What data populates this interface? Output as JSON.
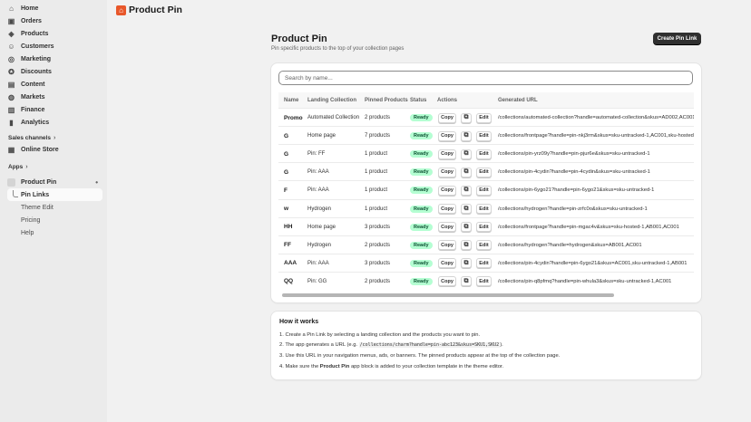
{
  "sidebar": {
    "nav": [
      {
        "label": "Home",
        "icon": "home-icon",
        "glyph": "⌂"
      },
      {
        "label": "Orders",
        "icon": "orders-icon",
        "glyph": "▣"
      },
      {
        "label": "Products",
        "icon": "products-icon",
        "glyph": "◈"
      },
      {
        "label": "Customers",
        "icon": "customers-icon",
        "glyph": "☺"
      },
      {
        "label": "Marketing",
        "icon": "marketing-icon",
        "glyph": "◎"
      },
      {
        "label": "Discounts",
        "icon": "discounts-icon",
        "glyph": "✪"
      },
      {
        "label": "Content",
        "icon": "content-icon",
        "glyph": "▤"
      },
      {
        "label": "Markets",
        "icon": "markets-icon",
        "glyph": "◍"
      },
      {
        "label": "Finance",
        "icon": "finance-icon",
        "glyph": "▥"
      },
      {
        "label": "Analytics",
        "icon": "analytics-icon",
        "glyph": "▮"
      }
    ],
    "sales_channels_label": "Sales channels",
    "online_store_label": "Online Store",
    "apps_label": "Apps",
    "app_name": "Product Pin",
    "app_sub": [
      "Pin Links",
      "Theme Edit",
      "Pricing",
      "Help"
    ]
  },
  "header": {
    "title": "Product Pin"
  },
  "page": {
    "title": "Product Pin",
    "subtitle": "Pin specific products to the top of your collection pages",
    "create_button": "Create Pin Link",
    "search_placeholder": "Search by name..."
  },
  "table": {
    "columns": [
      "Name",
      "Landing Collection",
      "Pinned Products",
      "Status",
      "Actions",
      "Generated URL"
    ],
    "copy_label": "Copy",
    "edit_label": "Edit",
    "rows": [
      {
        "name": "Promo",
        "collection": "Automated Collection",
        "pinned": "2 products",
        "status": "Ready",
        "url": "/collections/automated-collection?handle=automated-collection&skus=AD002,AC001"
      },
      {
        "name": "G",
        "collection": "Home page",
        "pinned": "7 products",
        "status": "Ready",
        "url": "/collections/frontpage?handle=pin-nkj3rm&skus=sku-untracked-1,AC001,sku-hosted-1"
      },
      {
        "name": "G",
        "collection": "Pin: FF",
        "pinned": "1 product",
        "status": "Ready",
        "url": "/collections/pin-yrz09y?handle=pin-pjur6e&skus=sku-untracked-1"
      },
      {
        "name": "G",
        "collection": "Pin: AAA",
        "pinned": "1 product",
        "status": "Ready",
        "url": "/collections/pin-4cydin?handle=pin-4cydin&skus=sku-untracked-1"
      },
      {
        "name": "F",
        "collection": "Pin: AAA",
        "pinned": "1 product",
        "status": "Ready",
        "url": "/collections/pin-6ygo21?handle=pin-6ygo21&skus=sku-untracked-1"
      },
      {
        "name": "w",
        "collection": "Hydrogen",
        "pinned": "1 product",
        "status": "Ready",
        "url": "/collections/hydrogen?handle=pin-zrfc0o&skus=sku-untracked-1"
      },
      {
        "name": "HH",
        "collection": "Home page",
        "pinned": "3 products",
        "status": "Ready",
        "url": "/collections/frontpage?handle=pin-mgac4v&skus=sku-hosted-1,AB001,AC001"
      },
      {
        "name": "FF",
        "collection": "Hydrogen",
        "pinned": "2 products",
        "status": "Ready",
        "url": "/collections/hydrogen?handle=hydrogen&skus=AB001,AC001"
      },
      {
        "name": "AAA",
        "collection": "Pin: AAA",
        "pinned": "3 products",
        "status": "Ready",
        "url": "/collections/pin-4cydin?handle=pin-6ygo21&skus=AC001,sku-untracked-1,AB001"
      },
      {
        "name": "QQ",
        "collection": "Pin: GG",
        "pinned": "2 products",
        "status": "Ready",
        "url": "/collections/pin-q8pfmq?handle=pin-whula3&skus=sku-untracked-1,AC001"
      }
    ]
  },
  "how": {
    "title": "How it works",
    "step1": "1. Create a Pin Link by selecting a landing collection and the products you want to pin.",
    "step2_pre": "2. The app generates a URL (e.g. ",
    "step2_code": "/collections/charm?handle=pin-abc123&skus=SKU1,SKU2",
    "step2_post": ").",
    "step3": "3. Use this URL in your navigation menus, ads, or banners. The pinned products appear at the top of the collection page.",
    "step4_pre": "4. Make sure the ",
    "step4_bold": "Product Pin",
    "step4_post": " app block is added to your collection template in the theme editor."
  },
  "colors": {
    "accent": "#303030",
    "badge_bg": "#b4fed2",
    "badge_text": "#0c5132",
    "logo": "#e8572a"
  }
}
